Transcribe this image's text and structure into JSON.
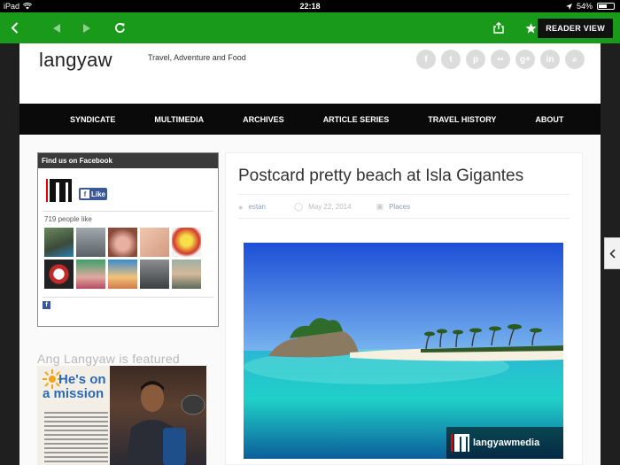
{
  "statusbar": {
    "device": "iPad",
    "time": "22:18",
    "battery": "54%",
    "battery_level": 0.54,
    "wifi_icon": "wifi-icon",
    "location_icon": "location-arrow-icon"
  },
  "browser": {
    "back_icon": "chevron-left-icon",
    "prev_icon": "triangle-left-icon",
    "next_icon": "triangle-right-icon",
    "reload_icon": "reload-icon",
    "share_icon": "share-icon",
    "bookmark_icon": "star-icon",
    "reader_label": "READER VIEW",
    "accent": "#1a9a1a"
  },
  "site": {
    "logo": "langyaw",
    "tagline": "Travel, Adventure and Food",
    "social": [
      {
        "name": "facebook-icon",
        "glyph": "f"
      },
      {
        "name": "twitter-icon",
        "glyph": "t"
      },
      {
        "name": "pinterest-icon",
        "glyph": "p"
      },
      {
        "name": "flickr-icon",
        "glyph": "••"
      },
      {
        "name": "googleplus-icon",
        "glyph": "g+"
      },
      {
        "name": "linkedin-icon",
        "glyph": "in"
      },
      {
        "name": "search-icon",
        "glyph": "⌕"
      }
    ],
    "nav": [
      "SYNDICATE",
      "MULTIMEDIA",
      "ARCHIVES",
      "ARTICLE SERIES",
      "TRAVEL HISTORY",
      "ABOUT"
    ]
  },
  "sidebar": {
    "fb_title": "Find us on Facebook",
    "fb_like": "Like",
    "fb_count": "719 people like",
    "featured_title": "Ang Langyaw is featured",
    "magazine_title_line1": "He's on",
    "magazine_title_line2": "a mission"
  },
  "article": {
    "title": "Postcard pretty beach at Isla Gigantes",
    "author": "estan",
    "date": "May 22, 2014",
    "category": "Places",
    "watermark": "langyawmedia"
  }
}
